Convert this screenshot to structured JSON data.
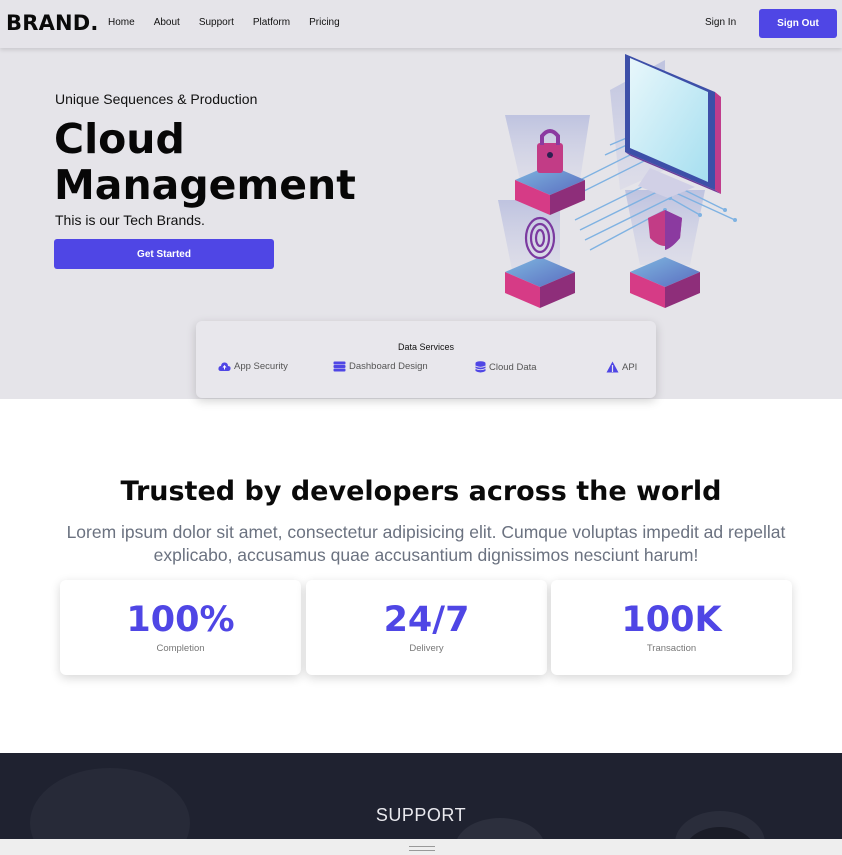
{
  "nav": {
    "brand": "BRAND.",
    "links": [
      "Home",
      "About",
      "Support",
      "Platform",
      "Pricing"
    ],
    "sign_in": "Sign In",
    "sign_out": "Sign Out"
  },
  "hero": {
    "eyebrow": "Unique Sequences & Production",
    "title_line1": "Cloud",
    "title_line2": "Management",
    "subtitle": "This is our Tech Brands.",
    "cta": "Get Started"
  },
  "data_services": {
    "title": "Data Services",
    "items": [
      {
        "label": "App Security",
        "icon": "cloud-upload-icon"
      },
      {
        "label": "Dashboard Design",
        "icon": "database-icon"
      },
      {
        "label": "Cloud Data",
        "icon": "stack-icon"
      },
      {
        "label": "API",
        "icon": "triangle-icon"
      }
    ]
  },
  "trusted": {
    "heading": "Trusted by developers across the world",
    "body": "Lorem ipsum dolor sit amet, consectetur adipisicing elit. Cumque voluptas impedit ad repellat explicabo, accusamus quae accusantium dignissimos nesciunt harum!",
    "stats": [
      {
        "value": "100%",
        "label": "Completion"
      },
      {
        "value": "24/7",
        "label": "Delivery"
      },
      {
        "value": "100K",
        "label": "Transaction"
      }
    ]
  },
  "support": {
    "title": "SUPPORT"
  },
  "colors": {
    "accent": "#4f46e5",
    "hero_bg": "#e5e4e9",
    "support_bg": "#1f2230"
  }
}
